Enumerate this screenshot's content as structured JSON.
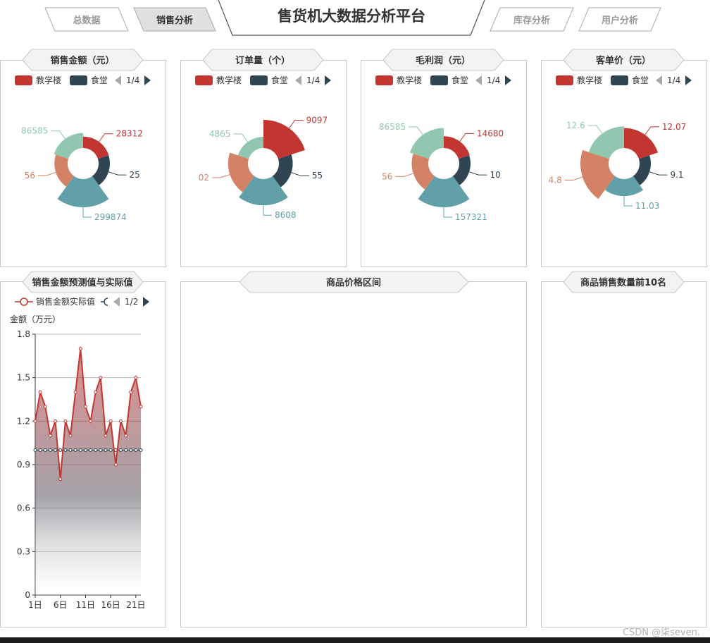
{
  "nav": {
    "tabs": [
      {
        "label": "总数据",
        "active": false
      },
      {
        "label": "销售分析",
        "active": true
      },
      {
        "label": "库存分析",
        "active": false
      },
      {
        "label": "用户分析",
        "active": false
      }
    ],
    "title": "售货机大数据分析平台"
  },
  "legend": {
    "series_a": "教学楼",
    "series_b": "食堂",
    "page": "1/4"
  },
  "colors": {
    "red": "#c23531",
    "navy": "#2f4554",
    "teal": "#61a0a8",
    "orange": "#d48265",
    "green": "#91c7ae"
  },
  "chart_data": [
    {
      "type": "pie",
      "title": "销售金额（元）",
      "slice_labels": [
        "28312",
        "25",
        "299874",
        "56",
        "86585"
      ],
      "values": [
        28312,
        25000,
        299874,
        56000,
        86585
      ]
    },
    {
      "type": "pie",
      "title": "订单量（个）",
      "slice_labels": [
        "9097",
        "55",
        "8608",
        "02",
        "4865"
      ],
      "values": [
        9097,
        5500,
        8608,
        7002,
        4865
      ]
    },
    {
      "type": "pie",
      "title": "毛利润（元）",
      "slice_labels": [
        "14680",
        "10",
        "157321",
        "56",
        "86585"
      ],
      "values": [
        14680,
        10000,
        157321,
        56000,
        86585
      ]
    },
    {
      "type": "pie",
      "title": "客单价（元）",
      "slice_labels": [
        "12.07",
        "9.1",
        "11.03",
        "4.8",
        "12.6"
      ],
      "values": [
        12.07,
        9.1,
        11.03,
        14.8,
        12.6
      ]
    },
    {
      "type": "line",
      "title": "销售金额预测值与实际值",
      "legend": {
        "series_label": "销售金额实际值",
        "page": "1/2"
      },
      "ylabel": "金额（万元）",
      "ylim": [
        0,
        1.8
      ],
      "yticks": [
        0,
        0.3,
        0.6,
        0.9,
        1.2,
        1.5,
        1.8
      ],
      "x_tick_labels": [
        "1日",
        "6日",
        "11日",
        "16日",
        "21日"
      ],
      "x_tick_days": [
        1,
        6,
        11,
        16,
        21
      ],
      "x": [
        1,
        2,
        3,
        4,
        5,
        6,
        7,
        8,
        9,
        10,
        11,
        12,
        13,
        14,
        15,
        16,
        17,
        18,
        19,
        20,
        21,
        22
      ],
      "series": [
        {
          "name": "销售金额实际值",
          "values": [
            1.2,
            1.4,
            1.3,
            1.1,
            1.2,
            0.8,
            1.2,
            1.1,
            1.4,
            1.7,
            1.3,
            1.2,
            1.4,
            1.5,
            1.1,
            1.2,
            0.9,
            1.2,
            1.1,
            1.4,
            1.5,
            1.3
          ]
        },
        {
          "values": [
            1.0,
            1.0,
            1.0,
            1.0,
            1.0,
            1.0,
            1.0,
            1.0,
            1.0,
            1.0,
            1.0,
            1.0,
            1.0,
            1.0,
            1.0,
            1.0,
            1.0,
            1.0,
            1.0,
            1.0,
            1.0,
            1.0
          ]
        }
      ]
    }
  ],
  "panels": {
    "price_range": {
      "title": "商品价格区间"
    },
    "top10": {
      "title": "商品销售数量前10名"
    }
  },
  "watermark": "CSDN @柒seven."
}
